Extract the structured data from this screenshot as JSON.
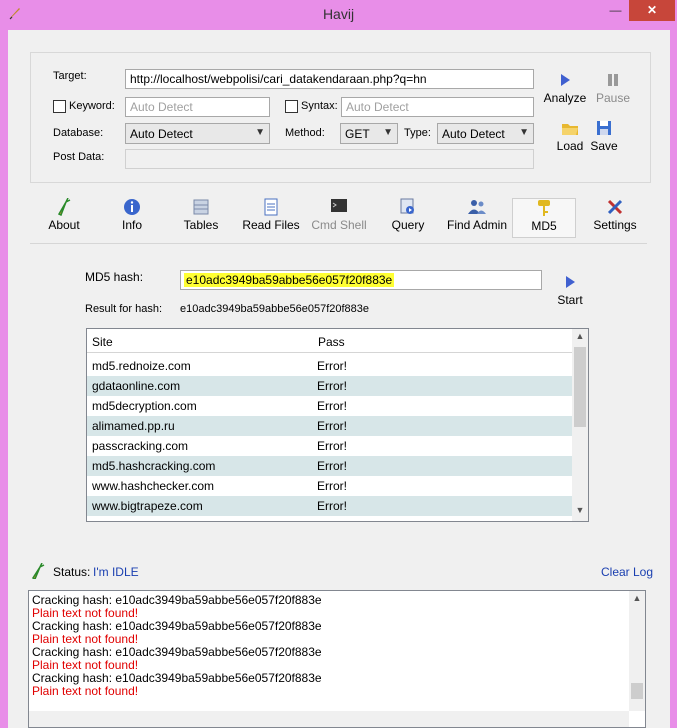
{
  "window": {
    "title": "Havij",
    "minimize": "—",
    "close": "✕",
    "icon": "feather-icon"
  },
  "form": {
    "target_label": "Target:",
    "target_value": "http://localhost/webpolisi/cari_datakendaraan.php?q=hn",
    "keyword_label": "Keyword:",
    "keyword_placeholder": "Auto Detect",
    "syntax_label": "Syntax:",
    "syntax_placeholder": "Auto Detect",
    "database_label": "Database:",
    "database_value": "Auto Detect",
    "method_label": "Method:",
    "method_value": "GET",
    "type_label": "Type:",
    "type_value": "Auto Detect",
    "postdata_label": "Post Data:"
  },
  "actions": {
    "analyze": "Analyze",
    "pause": "Pause",
    "load": "Load",
    "save": "Save"
  },
  "tabs": [
    {
      "label": "About",
      "icon": "carrot-icon"
    },
    {
      "label": "Info",
      "icon": "info-icon"
    },
    {
      "label": "Tables",
      "icon": "table-icon"
    },
    {
      "label": "Read Files",
      "icon": "document-icon"
    },
    {
      "label": "Cmd Shell",
      "icon": "terminal-icon"
    },
    {
      "label": "Query",
      "icon": "query-icon"
    },
    {
      "label": "Find Admin",
      "icon": "users-icon"
    },
    {
      "label": "MD5",
      "icon": "key-icon"
    },
    {
      "label": "Settings",
      "icon": "tools-icon"
    }
  ],
  "md5": {
    "hash_label": "MD5 hash:",
    "hash_value": "e10adc3949ba59abbe56e057f20f883e",
    "result_label": "Result for hash:",
    "result_value": "e10adc3949ba59abbe56e057f20f883e",
    "start": "Start",
    "columns": [
      "Site",
      "Pass"
    ],
    "rows": [
      {
        "site": "md5.rednoize.com",
        "pass": "Error!"
      },
      {
        "site": "gdataonline.com",
        "pass": "Error!"
      },
      {
        "site": "md5decryption.com",
        "pass": "Error!"
      },
      {
        "site": "alimamed.pp.ru",
        "pass": "Error!"
      },
      {
        "site": "passcracking.com",
        "pass": "Error!"
      },
      {
        "site": "md5.hashcracking.com",
        "pass": "Error!"
      },
      {
        "site": "www.hashchecker.com",
        "pass": "Error!"
      },
      {
        "site": "www.bigtrapeze.com",
        "pass": "Error!"
      }
    ]
  },
  "status": {
    "label": "Status:",
    "value": "I'm IDLE",
    "clear_log": "Clear Log"
  },
  "log": [
    {
      "text": "Cracking hash: e10adc3949ba59abbe56e057f20f883e",
      "error": false
    },
    {
      "text": "Plain text not found!",
      "error": true
    },
    {
      "text": "Cracking hash: e10adc3949ba59abbe56e057f20f883e",
      "error": false
    },
    {
      "text": "Plain text not found!",
      "error": true
    },
    {
      "text": "Cracking hash: e10adc3949ba59abbe56e057f20f883e",
      "error": false
    },
    {
      "text": "Plain text not found!",
      "error": true
    },
    {
      "text": "Cracking hash: e10adc3949ba59abbe56e057f20f883e",
      "error": false
    },
    {
      "text": "Plain text not found!",
      "error": true
    }
  ],
  "colors": {
    "titlebar": "#e88ee8",
    "close": "#c7463a",
    "highlight": "#ffff33",
    "alt_row": "#d7e6e8",
    "error_text": "#e00000",
    "link": "#1a3fb0"
  }
}
